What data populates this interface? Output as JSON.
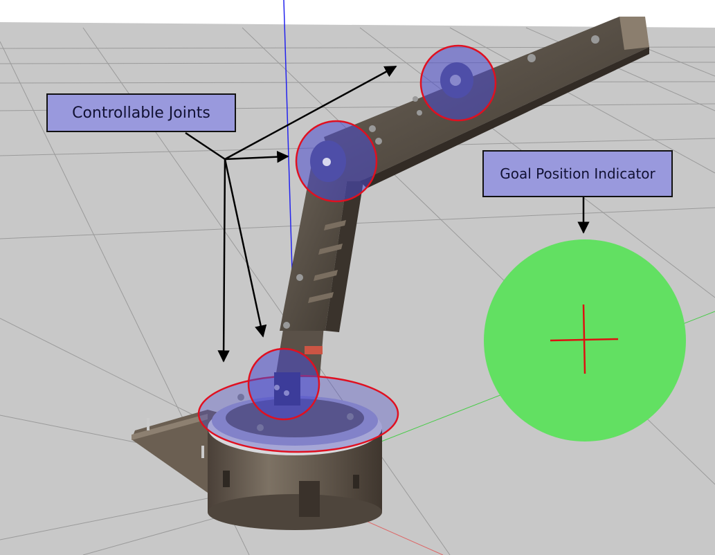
{
  "labels": {
    "controllable_joints": "Controllable Joints",
    "goal_position_indicator": "Goal Position Indicator"
  },
  "colors": {
    "background": "#c8c8c8",
    "link": "#5a5148",
    "joint_highlight": "#4a4acc",
    "joint_outline": "#e01020",
    "goal_sphere": "#62e062",
    "goal_cross": "#dd1111",
    "callout_fill": "#9999dd"
  }
}
